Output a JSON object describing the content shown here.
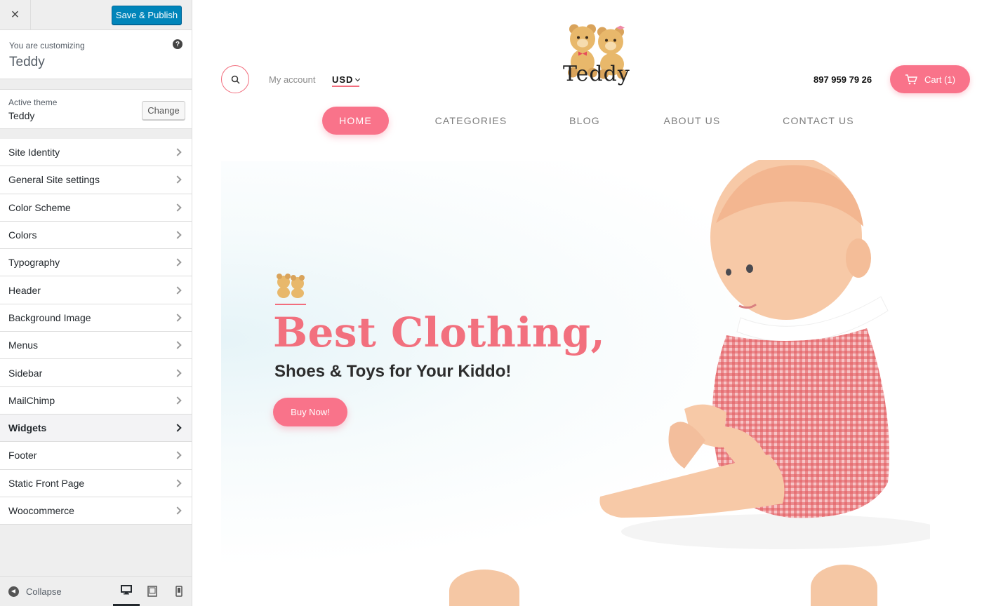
{
  "sidebar": {
    "close_label": "×",
    "save_label": "Save & Publish",
    "customizing_label": "You are customizing",
    "customizing_name": "Teddy",
    "help_label": "?",
    "active_theme_label": "Active theme",
    "active_theme_name": "Teddy",
    "change_label": "Change",
    "items": [
      {
        "label": "Site Identity"
      },
      {
        "label": "General Site settings"
      },
      {
        "label": "Color Scheme"
      },
      {
        "label": "Colors"
      },
      {
        "label": "Typography"
      },
      {
        "label": "Header"
      },
      {
        "label": "Background Image"
      },
      {
        "label": "Menus"
      },
      {
        "label": "Sidebar"
      },
      {
        "label": "MailChimp"
      },
      {
        "label": "Widgets"
      },
      {
        "label": "Footer"
      },
      {
        "label": "Static Front Page"
      },
      {
        "label": "Woocommerce"
      }
    ],
    "active_item": "Widgets",
    "collapse_label": "Collapse",
    "devices": [
      "desktop-icon",
      "tablet-icon",
      "mobile-icon"
    ]
  },
  "preview": {
    "my_account": "My account",
    "currency": "USD",
    "logo_text": "Teddy",
    "phone": "897 959 79 26",
    "cart_label": "Cart (1)",
    "nav": [
      {
        "label": "HOME"
      },
      {
        "label": "CATEGORIES"
      },
      {
        "label": "BLOG"
      },
      {
        "label": "ABOUT US"
      },
      {
        "label": "CONTACT US"
      }
    ],
    "hero": {
      "headline": "Best Clothing,",
      "subline": "Shoes & Toys for Your Kiddo!",
      "button": "Buy Now!"
    }
  },
  "colors": {
    "accent": "#f9738a",
    "headline": "#f2707e",
    "wp_blue": "#0085ba"
  }
}
